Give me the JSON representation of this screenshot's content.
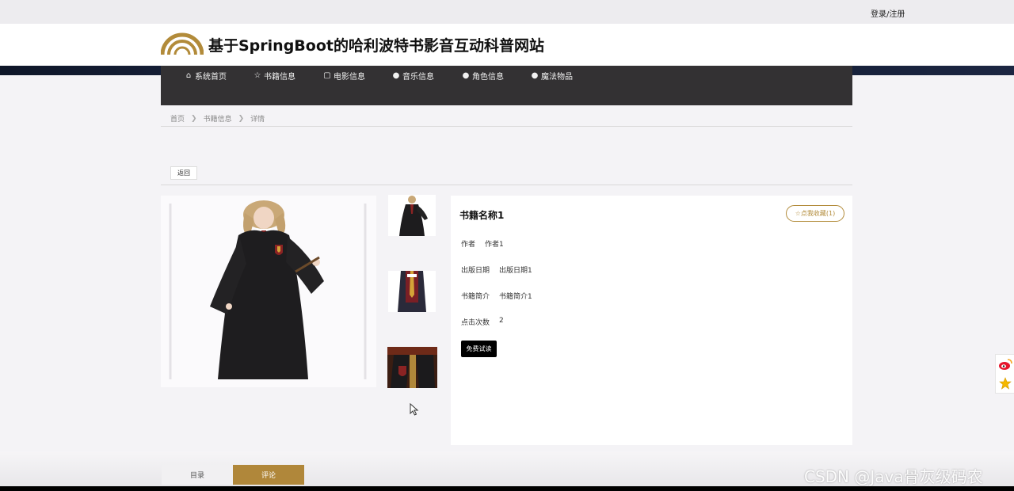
{
  "topbar": {
    "login_label": "登录/注册"
  },
  "header": {
    "title": "基于SpringBoot的哈利波特书影音互动科普网站",
    "logo_icon": "arc-logo-icon",
    "logo_color": "#b28b3a"
  },
  "nav": {
    "items": [
      {
        "label": "系统首页",
        "icon": "home-icon"
      },
      {
        "label": "书籍信息",
        "icon": "star-icon"
      },
      {
        "label": "电影信息",
        "icon": "bag-icon"
      },
      {
        "label": "音乐信息",
        "icon": "info-icon"
      },
      {
        "label": "角色信息",
        "icon": "info-icon"
      },
      {
        "label": "魔法物品",
        "icon": "info-icon"
      }
    ]
  },
  "breadcrumb": {
    "items": [
      "首页",
      "书籍信息",
      "详情"
    ]
  },
  "actions": {
    "back_label": "返回"
  },
  "detail": {
    "book_name": "书籍名称1",
    "favorite_label": "☆点我收藏(1)",
    "fields": [
      {
        "label": "作者",
        "value": "作者1"
      },
      {
        "label": "出版日期",
        "value": "出版日期1"
      },
      {
        "label": "书籍简介",
        "value": "书籍简介1"
      },
      {
        "label": "点击次数",
        "value": "2"
      }
    ],
    "read_label": "免费试读"
  },
  "tabs": {
    "catalog_label": "目录",
    "comments_label": "评论"
  },
  "watermark": "CSDN @Java骨灰级码农",
  "colors": {
    "accent": "#b0873a",
    "nav_bg": "#333133",
    "read_button": "#000000"
  }
}
